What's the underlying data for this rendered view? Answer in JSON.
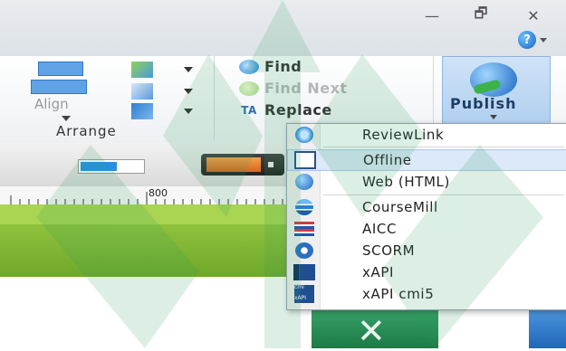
{
  "window": {
    "controls": {
      "minimize": "—",
      "maximize": "🗗",
      "close": "✕"
    },
    "help_label": "?"
  },
  "ribbon": {
    "arrange_group": {
      "align_label": "Align",
      "group_label": "Arrange"
    },
    "edit_group": {
      "find_label": "Find",
      "find_next_label": "Find Next",
      "replace_label": "Replace",
      "replace_icon_text": "TA"
    },
    "publish": {
      "label": "Publish"
    }
  },
  "timeline": {
    "ruler_marker": "800"
  },
  "publish_menu": {
    "items": [
      {
        "label": "ReviewLink",
        "icon": "reviewlink-icon"
      },
      {
        "label": "Offline",
        "icon": "offline-icon",
        "selected": true
      },
      {
        "label": "Web (HTML)",
        "icon": "web-html-icon"
      },
      {
        "label": "CourseMill",
        "icon": "coursemill-icon"
      },
      {
        "label": "AICC",
        "icon": "aicc-icon"
      },
      {
        "label": "SCORM",
        "icon": "scorm-icon"
      },
      {
        "label": "xAPI",
        "icon": "xapi-icon"
      },
      {
        "label": "xAPI cmi5",
        "icon": "xapi-cmi5-icon",
        "icon_text_top": "cmi",
        "icon_text_bottom": "xAPI"
      }
    ]
  },
  "colors": {
    "accent": "#1e7bd1",
    "track_green": "#8cc43a",
    "menu_highlight": "#dbe9f8",
    "watermark_green": "#2e9e5e"
  }
}
